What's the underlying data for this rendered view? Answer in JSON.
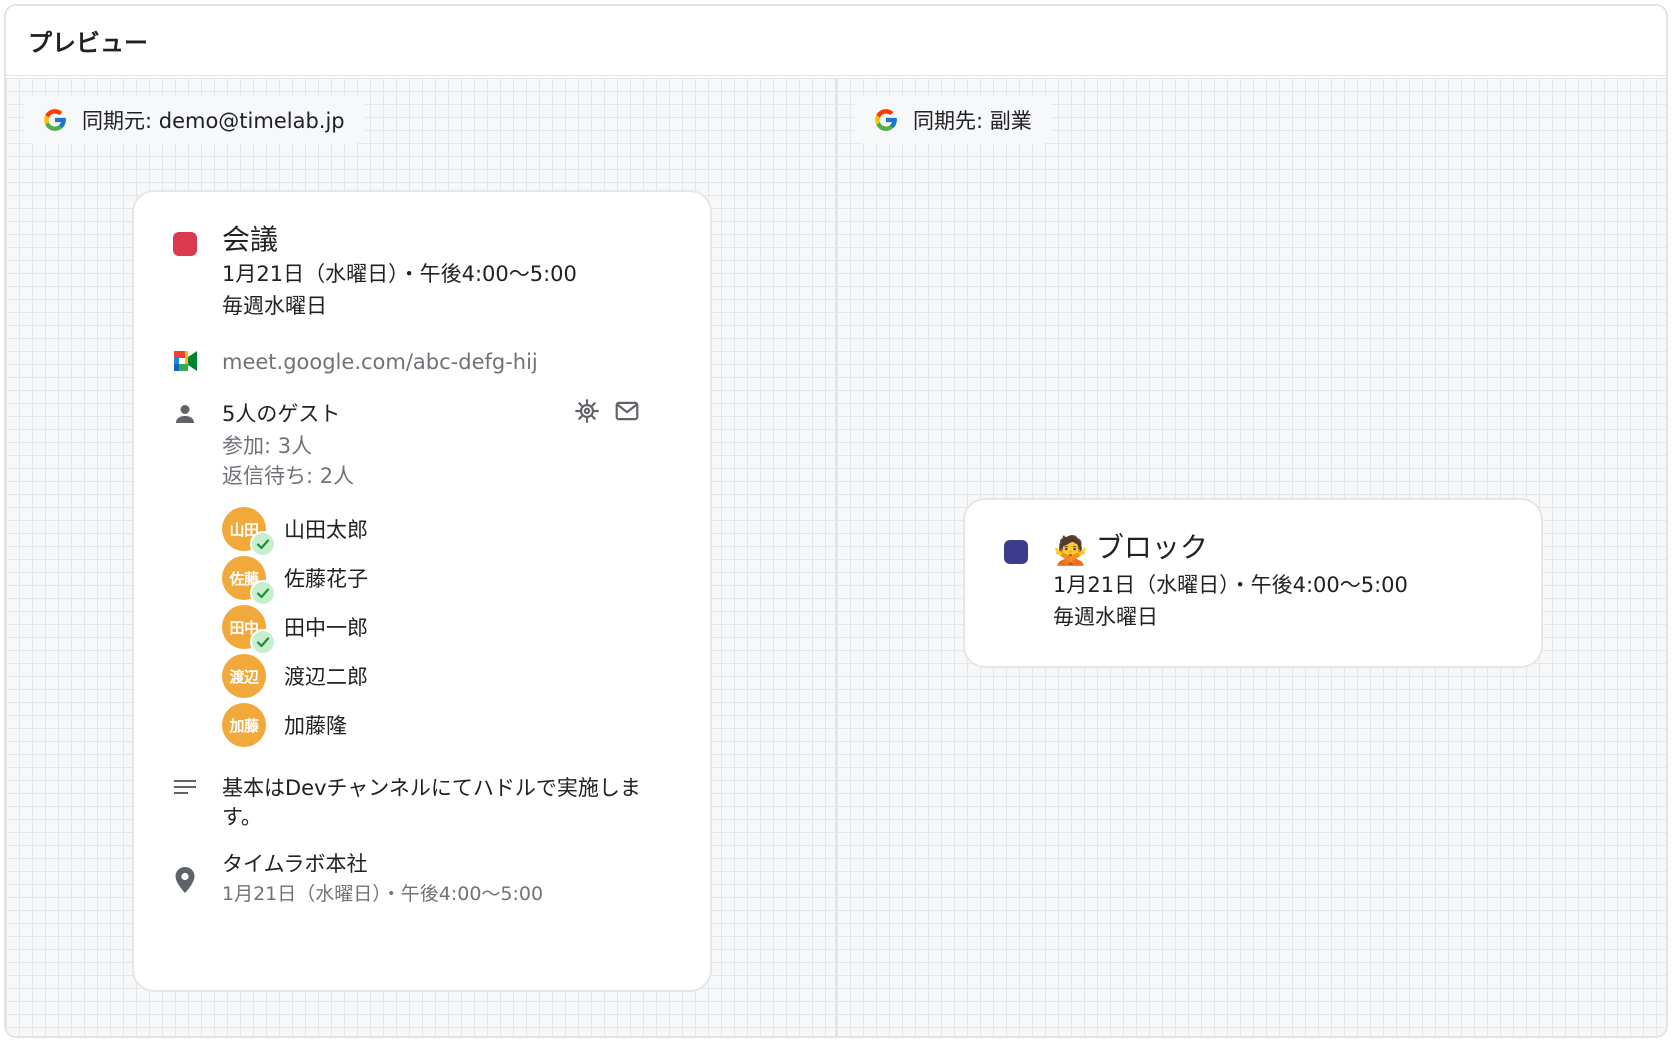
{
  "header": {
    "title": "プレビュー"
  },
  "source": {
    "chip_label": "同期元: demo@timelab.jp",
    "event": {
      "color": "#d93a4f",
      "title": "会議",
      "datetime": "1月21日（水曜日）・午後4:00〜5:00",
      "recurrence": "毎週水曜日",
      "meet_link": "meet.google.com/abc-defg-hij",
      "guests_title": "5人のゲスト",
      "guests_accepted": "参加: 3人",
      "guests_pending": "返信待ち: 2人",
      "guests": [
        {
          "initials": "山田",
          "name": "山田太郎",
          "accepted": true
        },
        {
          "initials": "佐藤",
          "name": "佐藤花子",
          "accepted": true
        },
        {
          "initials": "田中",
          "name": "田中一郎",
          "accepted": true
        },
        {
          "initials": "渡辺",
          "name": "渡辺二郎",
          "accepted": false
        },
        {
          "initials": "加藤",
          "name": "加藤隆",
          "accepted": false
        }
      ],
      "description_line1": "基本はDevチャンネルにてハドルで実施しま",
      "description_line2": "す。",
      "location_name": "タイムラボ本社",
      "location_datetime": "1月21日（水曜日）・午後4:00〜5:00"
    }
  },
  "destination": {
    "chip_label": "同期先: 副業",
    "event": {
      "color": "#3b3a8c",
      "emoji": "🙅",
      "title": "ブロック",
      "datetime": "1月21日（水曜日）・午後4:00〜5:00",
      "recurrence": "毎週水曜日"
    }
  },
  "icons": {
    "chip_icon": "google-g-icon",
    "meet_icon": "google-meet-icon",
    "guests_icon": "person-icon",
    "settings_icon": "gear-icon",
    "email_icon": "mail-icon",
    "description_icon": "notes-icon",
    "location_icon": "location-pin-icon",
    "accepted_icon": "check-icon"
  }
}
